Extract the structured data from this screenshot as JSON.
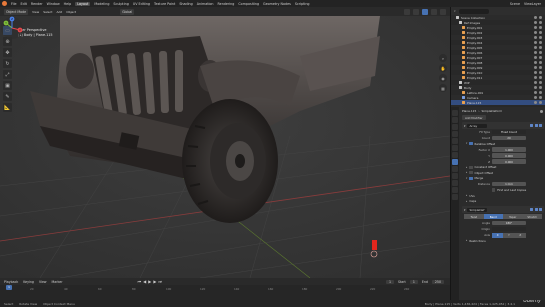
{
  "menubar": {
    "items": [
      "File",
      "Edit",
      "Render",
      "Window",
      "Help"
    ],
    "workspaces": [
      "Layout",
      "Modeling",
      "Sculpting",
      "UV Editing",
      "Texture Paint",
      "Shading",
      "Animation",
      "Rendering",
      "Compositing",
      "Geometry Nodes",
      "Scripting"
    ],
    "active_workspace": "Layout",
    "scene_label": "Scene",
    "viewlayer_label": "ViewLayer"
  },
  "viewport_header": {
    "mode": "Object Mode",
    "menus": [
      "View",
      "Select",
      "Add",
      "Object"
    ],
    "transform_orientation": "Global",
    "options_label": "Options"
  },
  "tool_header": {
    "orientation_label": "Orientation:",
    "orientation_value": "Default",
    "drag_label": "Drag:",
    "drag_value": "Select Box"
  },
  "viewport": {
    "view_name": "User Perspective",
    "collection_info": "(1) Body | Plane.115"
  },
  "gizmo": {
    "x": "X",
    "y": "Y",
    "z": "Z"
  },
  "timeline": {
    "menus": [
      "Playback",
      "Keying",
      "View",
      "Marker"
    ],
    "current_frame": "1",
    "start_label": "Start",
    "start_value": "1",
    "end_label": "End",
    "end_value": "250",
    "ticks": [
      "0",
      "20",
      "40",
      "60",
      "80",
      "100",
      "120",
      "140",
      "160",
      "180",
      "200",
      "220",
      "240"
    ]
  },
  "statusbar": {
    "items": [
      "Select",
      "Rotate View",
      "Object Context Menu"
    ],
    "stats": "Body | Plane.115 | Verts 1,436,424 | Faces 1,425,052 | 3.4.1"
  },
  "watermark": "Udemy",
  "outliner": {
    "rows": [
      {
        "label": "Scene Collection",
        "icon": "col",
        "selected": false
      },
      {
        "label": "Ref Images",
        "icon": "col",
        "selected": false
      },
      {
        "label": "Empty.001",
        "icon": "obj",
        "selected": false
      },
      {
        "label": "Empty.002",
        "icon": "obj",
        "selected": false
      },
      {
        "label": "Empty.003",
        "icon": "obj",
        "selected": false
      },
      {
        "label": "Empty.004",
        "icon": "obj",
        "selected": false
      },
      {
        "label": "Empty.005",
        "icon": "obj",
        "selected": false
      },
      {
        "label": "Empty.006",
        "icon": "obj",
        "selected": false
      },
      {
        "label": "Empty.007",
        "icon": "obj",
        "selected": false
      },
      {
        "label": "Empty.008",
        "icon": "obj",
        "selected": false
      },
      {
        "label": "Empty.009",
        "icon": "obj",
        "selected": false
      },
      {
        "label": "Empty.010",
        "icon": "obj",
        "selected": false
      },
      {
        "label": "Empty.011",
        "icon": "obj",
        "selected": false
      },
      {
        "label": "WIP",
        "icon": "col",
        "selected": false
      },
      {
        "label": "Body",
        "icon": "col",
        "selected": false
      },
      {
        "label": "Lattice.001",
        "icon": "obj",
        "selected": false
      },
      {
        "label": "Camera",
        "icon": "cam",
        "selected": false
      },
      {
        "label": "Plane.115",
        "icon": "obj",
        "selected": true
      }
    ]
  },
  "properties": {
    "object_name": "Plane.115",
    "modifier_stack": "SimpleDeform",
    "add_modifier": "Add Modifier",
    "array": {
      "name": "Array",
      "fit_type_label": "Fit Type",
      "fit_type_value": "Fixed Count",
      "count_label": "Count",
      "count_value": "20",
      "relative_offset_label": "Relative Offset",
      "factor_x_label": "Factor X",
      "factor_x_value": "1.000",
      "y_label": "Y",
      "y_value": "0.000",
      "z_label": "Z",
      "z_value": "0.000",
      "constant_offset_label": "Constant Offset",
      "object_offset_label": "Object Offset",
      "merge_label": "Merge",
      "distance_label": "Distance",
      "distance_value": "1 mm",
      "first_last_label": "First and Last Copies",
      "uvs_label": "UVs",
      "caps_label": "Caps"
    },
    "simple_deform": {
      "name": "SimpleDef",
      "modes": [
        "Twist",
        "Bend",
        "Taper",
        "Stretch"
      ],
      "active_mode": "Bend",
      "angle_label": "Angle",
      "angle_value": "180°",
      "origin_label": "Origin",
      "axis_label": "Axis",
      "axes": [
        "X",
        "Y",
        "Z"
      ],
      "active_axis": "X",
      "restrictions_label": "Restrictions"
    }
  }
}
